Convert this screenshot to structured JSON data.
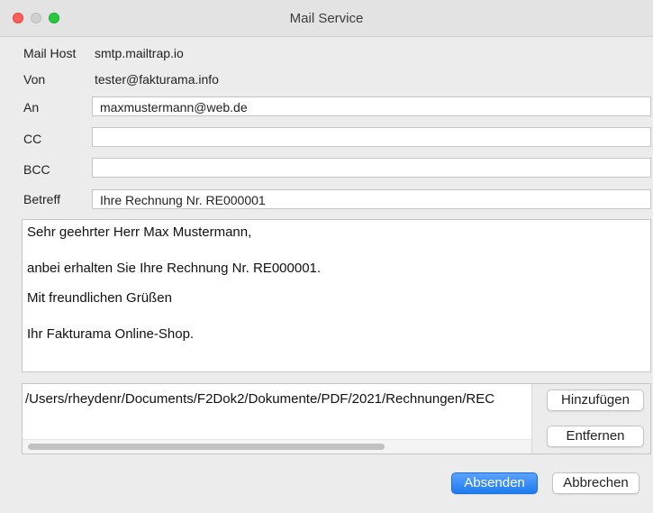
{
  "window": {
    "title": "Mail Service"
  },
  "form": {
    "mail_host": {
      "label": "Mail Host",
      "value": "smtp.mailtrap.io"
    },
    "from": {
      "label": "Von",
      "value": "tester@fakturama.info"
    },
    "to": {
      "label": "An",
      "value": "maxmustermann@web.de"
    },
    "cc": {
      "label": "CC",
      "value": ""
    },
    "bcc": {
      "label": "BCC",
      "value": ""
    },
    "subject": {
      "label": "Betreff",
      "value": "Ihre Rechnung Nr. RE000001"
    }
  },
  "message": {
    "lines": [
      "Sehr geehrter Herr Max Mustermann,",
      "anbei erhalten Sie Ihre Rechnung Nr. RE000001.",
      "Mit freundlichen Grüßen",
      "Ihr Fakturama Online-Shop."
    ]
  },
  "attachments": {
    "items": [
      "/Users/rheydenr/Documents/F2Dok2/Dokumente/PDF/2021/Rechnungen/REC"
    ],
    "add_label": "Hinzufügen",
    "remove_label": "Entfernen"
  },
  "actions": {
    "send_label": "Absenden",
    "cancel_label": "Abbrechen"
  },
  "colors": {
    "primary": "#1f7bf0",
    "close": "#fe5f57",
    "maximize": "#28c840"
  }
}
